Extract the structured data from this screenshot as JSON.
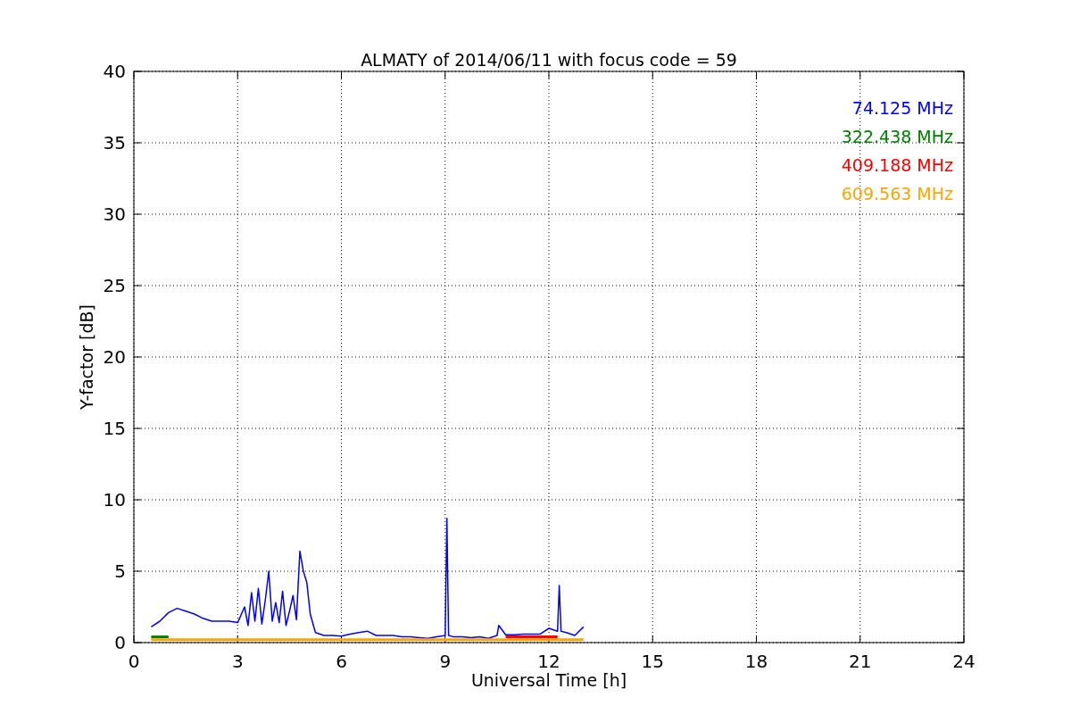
{
  "chart_data": {
    "type": "line",
    "title": "ALMATY of 2014/06/11 with focus code = 59",
    "xlabel": "Universal Time [h]",
    "ylabel": "Y-factor [dB]",
    "x": [
      0.5,
      0.75,
      1,
      1.25,
      1.5,
      1.75,
      2,
      2.25,
      2.5,
      2.75,
      3,
      3.2,
      3.3,
      3.4,
      3.5,
      3.6,
      3.7,
      3.8,
      3.9,
      4,
      4.1,
      4.2,
      4.3,
      4.4,
      4.5,
      4.6,
      4.7,
      4.8,
      4.9,
      5,
      5.1,
      5.25,
      5.5,
      5.75,
      6,
      6.25,
      6.5,
      6.75,
      7,
      7.25,
      7.5,
      7.75,
      8,
      8.25,
      8.5,
      8.75,
      9,
      9.05,
      9.1,
      9.25,
      9.5,
      9.75,
      10,
      10.25,
      10.5,
      10.55,
      10.75,
      11,
      11.25,
      11.5,
      11.75,
      12,
      12.25,
      12.3,
      12.35,
      12.5,
      12.75,
      13
    ],
    "series": [
      {
        "name": "74.125 MHz",
        "color": "#0000ff",
        "values": [
          1.1,
          1.5,
          2.1,
          2.4,
          2.2,
          2.0,
          1.7,
          1.5,
          1.5,
          1.5,
          1.4,
          2.5,
          1.2,
          3.5,
          1.5,
          3.8,
          1.3,
          3.0,
          5.0,
          1.5,
          2.8,
          1.4,
          3.6,
          1.2,
          2.2,
          3.3,
          1.6,
          6.4,
          5.0,
          4.2,
          2.0,
          0.7,
          0.5,
          0.5,
          0.45,
          0.6,
          0.7,
          0.8,
          0.5,
          0.5,
          0.5,
          0.4,
          0.4,
          0.35,
          0.3,
          0.4,
          0.5,
          8.7,
          0.5,
          0.4,
          0.4,
          0.35,
          0.4,
          0.3,
          0.5,
          1.2,
          0.55,
          0.55,
          0.6,
          0.6,
          0.6,
          1.0,
          0.8,
          4.0,
          0.8,
          0.7,
          0.5,
          1.1
        ]
      },
      {
        "name": "322.438 MHz",
        "color": "#008000",
        "values": [
          0.4,
          0.4,
          0.4,
          null,
          null,
          null,
          null,
          null,
          null,
          null,
          null,
          null,
          null,
          null,
          null,
          null,
          null,
          null,
          null,
          null,
          null,
          null,
          null,
          null,
          null,
          null,
          null,
          null,
          null,
          null,
          null,
          null,
          null,
          null,
          null,
          null,
          null,
          null,
          null,
          null,
          null,
          null,
          null,
          null,
          null,
          null,
          null,
          null,
          null,
          null,
          null,
          null,
          null,
          null,
          null,
          null,
          null,
          null,
          null,
          null,
          null,
          null,
          null,
          null,
          null,
          null,
          null,
          null
        ]
      },
      {
        "name": "409.188 MHz",
        "color": "#ff0000",
        "values": [
          null,
          null,
          null,
          null,
          null,
          null,
          null,
          null,
          null,
          null,
          null,
          null,
          null,
          null,
          null,
          null,
          null,
          null,
          null,
          null,
          null,
          null,
          null,
          null,
          null,
          null,
          null,
          null,
          null,
          null,
          null,
          null,
          null,
          null,
          null,
          null,
          null,
          null,
          null,
          null,
          null,
          null,
          null,
          null,
          null,
          null,
          null,
          null,
          null,
          null,
          null,
          null,
          null,
          null,
          null,
          null,
          0.4,
          0.4,
          0.4,
          0.4,
          0.4,
          0.4,
          0.4,
          null,
          null,
          null,
          null,
          null
        ]
      },
      {
        "name": "609.563 MHz",
        "color": "#ffa500",
        "values": [
          0.2,
          0.2,
          0.2,
          0.2,
          0.2,
          0.2,
          0.2,
          0.2,
          0.2,
          0.2,
          0.2,
          0.2,
          0.2,
          0.2,
          0.2,
          0.2,
          0.2,
          0.2,
          0.2,
          0.2,
          0.2,
          0.2,
          0.2,
          0.2,
          0.2,
          0.2,
          0.2,
          0.2,
          0.2,
          0.2,
          0.2,
          0.2,
          0.2,
          0.2,
          0.2,
          0.2,
          0.2,
          0.2,
          0.2,
          0.2,
          0.2,
          0.2,
          0.2,
          0.2,
          0.2,
          0.2,
          0.2,
          0.2,
          0.2,
          0.2,
          0.2,
          0.2,
          0.2,
          0.2,
          0.2,
          0.2,
          0.2,
          0.2,
          0.2,
          0.2,
          0.2,
          0.2,
          0.2,
          0.2,
          0.2,
          0.2,
          0.2,
          0.2
        ]
      }
    ],
    "grid": true,
    "xlim": [
      0,
      24
    ],
    "ylim": [
      0,
      40
    ],
    "xticks": [
      0,
      3,
      6,
      9,
      12,
      15,
      18,
      21,
      24
    ],
    "yticks": [
      0,
      5,
      10,
      15,
      20,
      25,
      30,
      35,
      40
    ]
  }
}
